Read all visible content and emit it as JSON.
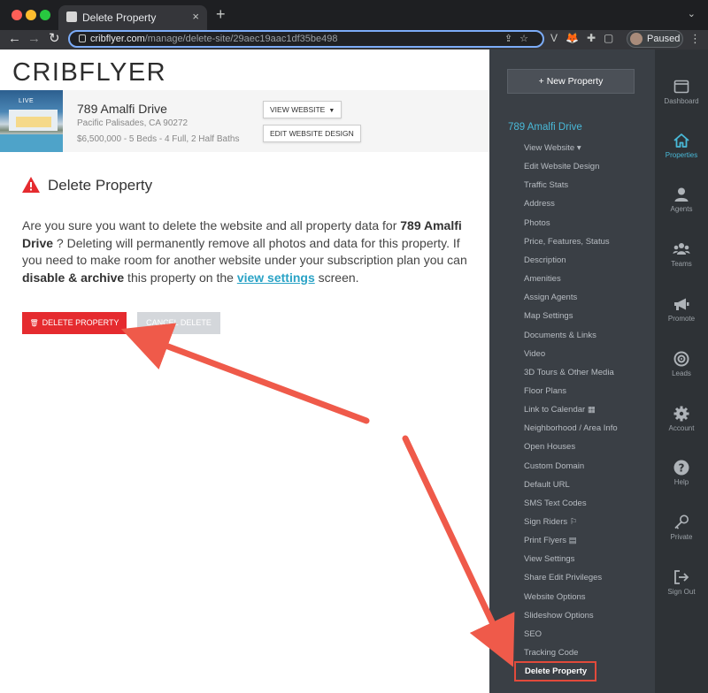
{
  "browser": {
    "tab_title": "Delete Property",
    "tab_close": "×",
    "new_tab": "+",
    "tab_menu": "⌄",
    "url_host": "cribflyer.com",
    "url_path": "/manage/delete-site/29aec19aac1df35be498",
    "profile_label": "Paused",
    "kebab": "⋮",
    "omnibox_icons": "⇪☆",
    "extension_icons": "V🦊✚▢"
  },
  "brand": "CRIBFLYER",
  "property": {
    "badge": "LIVE",
    "name": "789 Amalfi Drive",
    "location": "Pacific Palisades, CA 90272",
    "specs": "$6,500,000 - 5 Beds - 4 Full, 2 Half Baths",
    "view_website_label": "VIEW WEBSITE",
    "edit_design_label": "EDIT WEBSITE DESIGN"
  },
  "delete": {
    "title": "Delete Property",
    "text_1": "Are you sure you want to delete the website and all property data for ",
    "property_name": "789 Amalfi Drive",
    "text_2": " ? Deleting will permanently remove all photos and data for this property. If you need to make room for another website under your subscription plan you can ",
    "disable_archive": "disable & archive",
    "text_3": " this property on the ",
    "view_settings": "view settings",
    "text_4": " screen.",
    "delete_button": "DELETE PROPERTY",
    "cancel_button": "CANCEL DELETE"
  },
  "sidebar": {
    "new_property": "+ New Property",
    "heading": "789 Amalfi Drive",
    "items": [
      "View Website ▾",
      "Edit Website Design",
      "Traffic Stats",
      "Address",
      "Photos",
      "Price, Features, Status",
      "Description",
      "Amenities",
      "Assign Agents",
      "Map Settings",
      "Documents & Links",
      "Video",
      "3D Tours & Other Media",
      "Floor Plans",
      "Link to Calendar ▦",
      "Neighborhood / Area Info",
      "Open Houses",
      "Custom Domain",
      "Default URL",
      "SMS Text Codes",
      "Sign Riders ⚐",
      "Print Flyers ▤",
      "View Settings",
      "Share Edit Privileges",
      "Website Options",
      "Slideshow Options",
      "SEO",
      "Tracking Code"
    ],
    "active_item": "Delete Property"
  },
  "rail": [
    {
      "label": "Dashboard",
      "icon": "window-icon"
    },
    {
      "label": "Properties",
      "icon": "home-icon",
      "active": true
    },
    {
      "label": "Agents",
      "icon": "user-icon"
    },
    {
      "label": "Teams",
      "icon": "team-icon"
    },
    {
      "label": "Promote",
      "icon": "megaphone-icon"
    },
    {
      "label": "Leads",
      "icon": "target-icon"
    },
    {
      "label": "Account",
      "icon": "gear-icon"
    },
    {
      "label": "Help",
      "icon": "help-icon"
    },
    {
      "label": "Private",
      "icon": "key-icon"
    },
    {
      "label": "Sign Out",
      "icon": "signout-icon"
    }
  ],
  "colors": {
    "accent": "#49b9d8",
    "danger": "#e52b2f",
    "annotation": "#ef5a4a"
  }
}
